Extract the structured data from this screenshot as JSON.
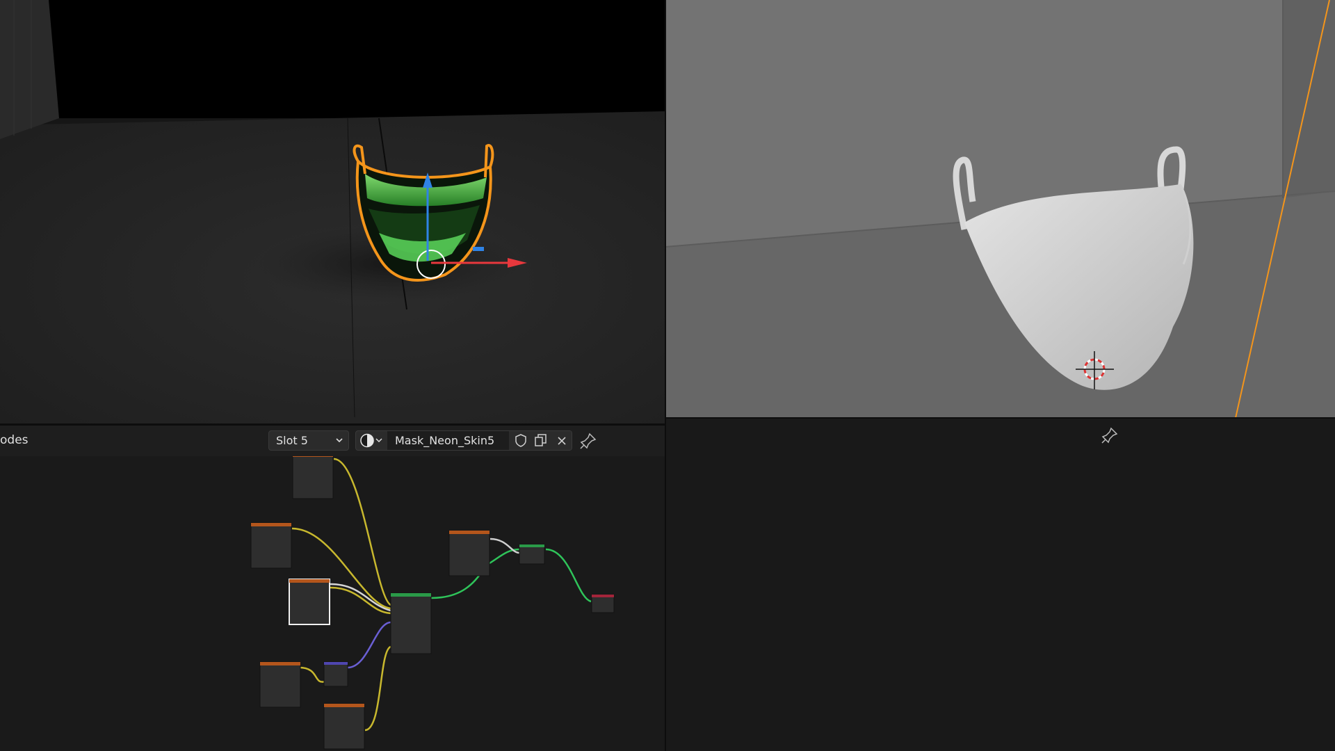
{
  "node_editor": {
    "editor_label": "odes",
    "slot_label": "Slot 5",
    "material_name": "Mask_Neon_Skin5"
  },
  "icons": {
    "material_browse": "material-sphere-icon",
    "fake_user": "shield-icon",
    "duplicate": "copy-icon",
    "unlink": "close-icon",
    "pin": "pin-icon"
  },
  "colors": {
    "selection_outline": "#f4951b",
    "axis_x": "#e8383d",
    "axis_z": "#2f83e6",
    "wire_color": "#c8b82e",
    "wire_shader": "#2fc45a",
    "wire_vector": "#6a5fd4"
  }
}
